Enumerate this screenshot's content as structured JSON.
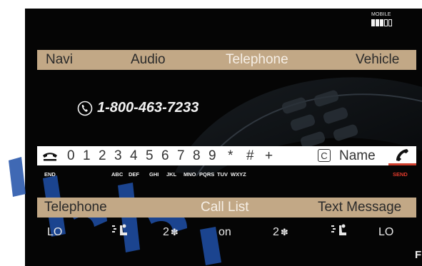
{
  "status": {
    "signal_label": "MOBILE",
    "signal_level": 3,
    "signal_max": 5
  },
  "top_menu": {
    "items": [
      "Navi",
      "Audio",
      "Telephone",
      "Vehicle"
    ],
    "active": "Telephone"
  },
  "dial": {
    "number": "1-800-463-7233"
  },
  "keypad": {
    "end_label": "END",
    "digits": [
      "0",
      "1",
      "2",
      "3",
      "4",
      "5",
      "6",
      "7",
      "8",
      "9",
      "*",
      "#",
      "+"
    ],
    "clear_label": "C",
    "name_label": "Name",
    "send_label": "SEND",
    "letters": [
      "ABC",
      "DEF",
      "GHI",
      "JKL",
      "MNO",
      "PQRS",
      "TUV",
      "WXYZ"
    ]
  },
  "bottom_menu": {
    "items": [
      "Telephone",
      "Call List",
      "Text Message"
    ],
    "active": "Call List"
  },
  "climate": {
    "left_temp": "LO",
    "left_fan": "2",
    "mode": "on",
    "right_fan": "2",
    "right_temp": "LO"
  },
  "corner_text": "F",
  "colors": {
    "menu_bar": "#c2a886",
    "active_text": "#f6efe6",
    "send": "#e03a2c"
  }
}
